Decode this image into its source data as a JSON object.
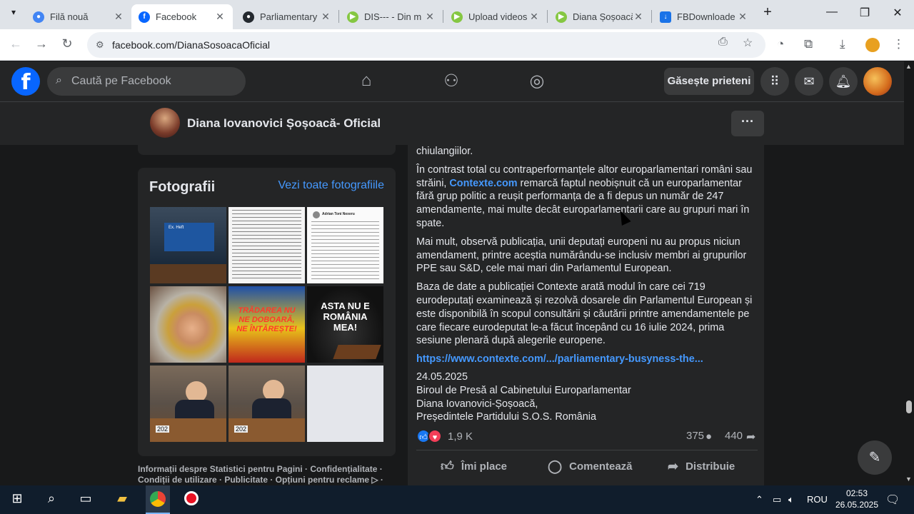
{
  "browser": {
    "tabs": [
      {
        "label": "Filă nouă",
        "icon": "chrome-icon"
      },
      {
        "label": "Facebook",
        "icon": "facebook-icon",
        "active": true
      },
      {
        "label": "Parliamentary",
        "icon": "github-icon"
      },
      {
        "label": "DIS--- - Din m",
        "icon": "rumble-icon"
      },
      {
        "label": "Upload videos",
        "icon": "rumble-icon"
      },
      {
        "label": "Diana Șoșoacă",
        "icon": "rumble-icon"
      },
      {
        "label": "FBDownloade",
        "icon": "download-icon"
      }
    ],
    "url": "facebook.com/DianaSosoacaOficial"
  },
  "facebook": {
    "search_placeholder": "Caută pe Facebook",
    "find_friends_label": "Găsește prieteni",
    "page_name": "Diana Iovanovici Șoșoacă- Oficial"
  },
  "photos": {
    "title": "Fotografii",
    "see_all": "Vezi toate fotografiile",
    "tiles": [
      {
        "caption": "",
        "text": "Ex. Heft"
      },
      {
        "caption": "",
        "text": ""
      },
      {
        "caption": "",
        "text": "Adrian Toni Nexeru"
      },
      {
        "caption": "",
        "text": ""
      },
      {
        "caption": "",
        "text": "TRĂDAREA NU NE DOBOARĂ, NE ÎNTĂREȘTE!"
      },
      {
        "caption": "",
        "text": "ASTA NU E ROMÂNIA MEA!"
      },
      {
        "caption": "",
        "text": "202"
      },
      {
        "caption": "",
        "text": "202"
      },
      {
        "caption": "",
        "text": ""
      }
    ]
  },
  "footer": {
    "line1": "Informații despre Statistici pentru Pagini · Confidențialitate ·",
    "line2": "Condiții de utilizare · Publicitate · Opțiuni pentru reclame ▷ ·"
  },
  "post": {
    "p0": "chiulangiilor.",
    "p1_before": "În contrast total cu contraperformanțele altor europarlamentari români sau străini, ",
    "p1_link": "Contexte.com",
    "p1_after": " remarcă faptul neobișnuit că un europarlamentar fără grup politic a reușit performanța de a fi depus un număr de 247 amendamente, mai multe decât europarlamentarii care au grupuri mari în spate.",
    "p2": "Mai mult, observă publicația, unii deputați europeni nu au propus niciun amendament, printre aceștia numărându-se inclusiv membri ai grupurilor PPE sau S&D, cele mai mari din Parlamentul European.",
    "p3": "Baza de date a publicației Contexte arată modul în care cei 719 eurodeputați examinează și rezolvă dosarele din Parlamentul European și este disponibilă în scopul consultării și căutării printre amendamentele pe care fiecare eurodeputat le-a făcut începând cu 16 iulie 2024, prima sesiune plenară după alegerile europene.",
    "link": "https://www.contexte.com/.../parliamentary-busyness-the...",
    "date": "24.05.2025",
    "sig1": "Biroul de Presă al Cabinetului Europarlamentar",
    "sig2": "Diana Iovanovici-Șoșoacă,",
    "sig3": "Președintele Partidului S.O.S. România",
    "reaction_count": "1,9 K",
    "comment_count": "375",
    "share_count": "440",
    "like_label": "Îmi place",
    "comment_label": "Comentează",
    "share_label": "Distribuie"
  },
  "taskbar": {
    "lang": "ROU",
    "time": "02:53",
    "date": "26.05.2025"
  }
}
